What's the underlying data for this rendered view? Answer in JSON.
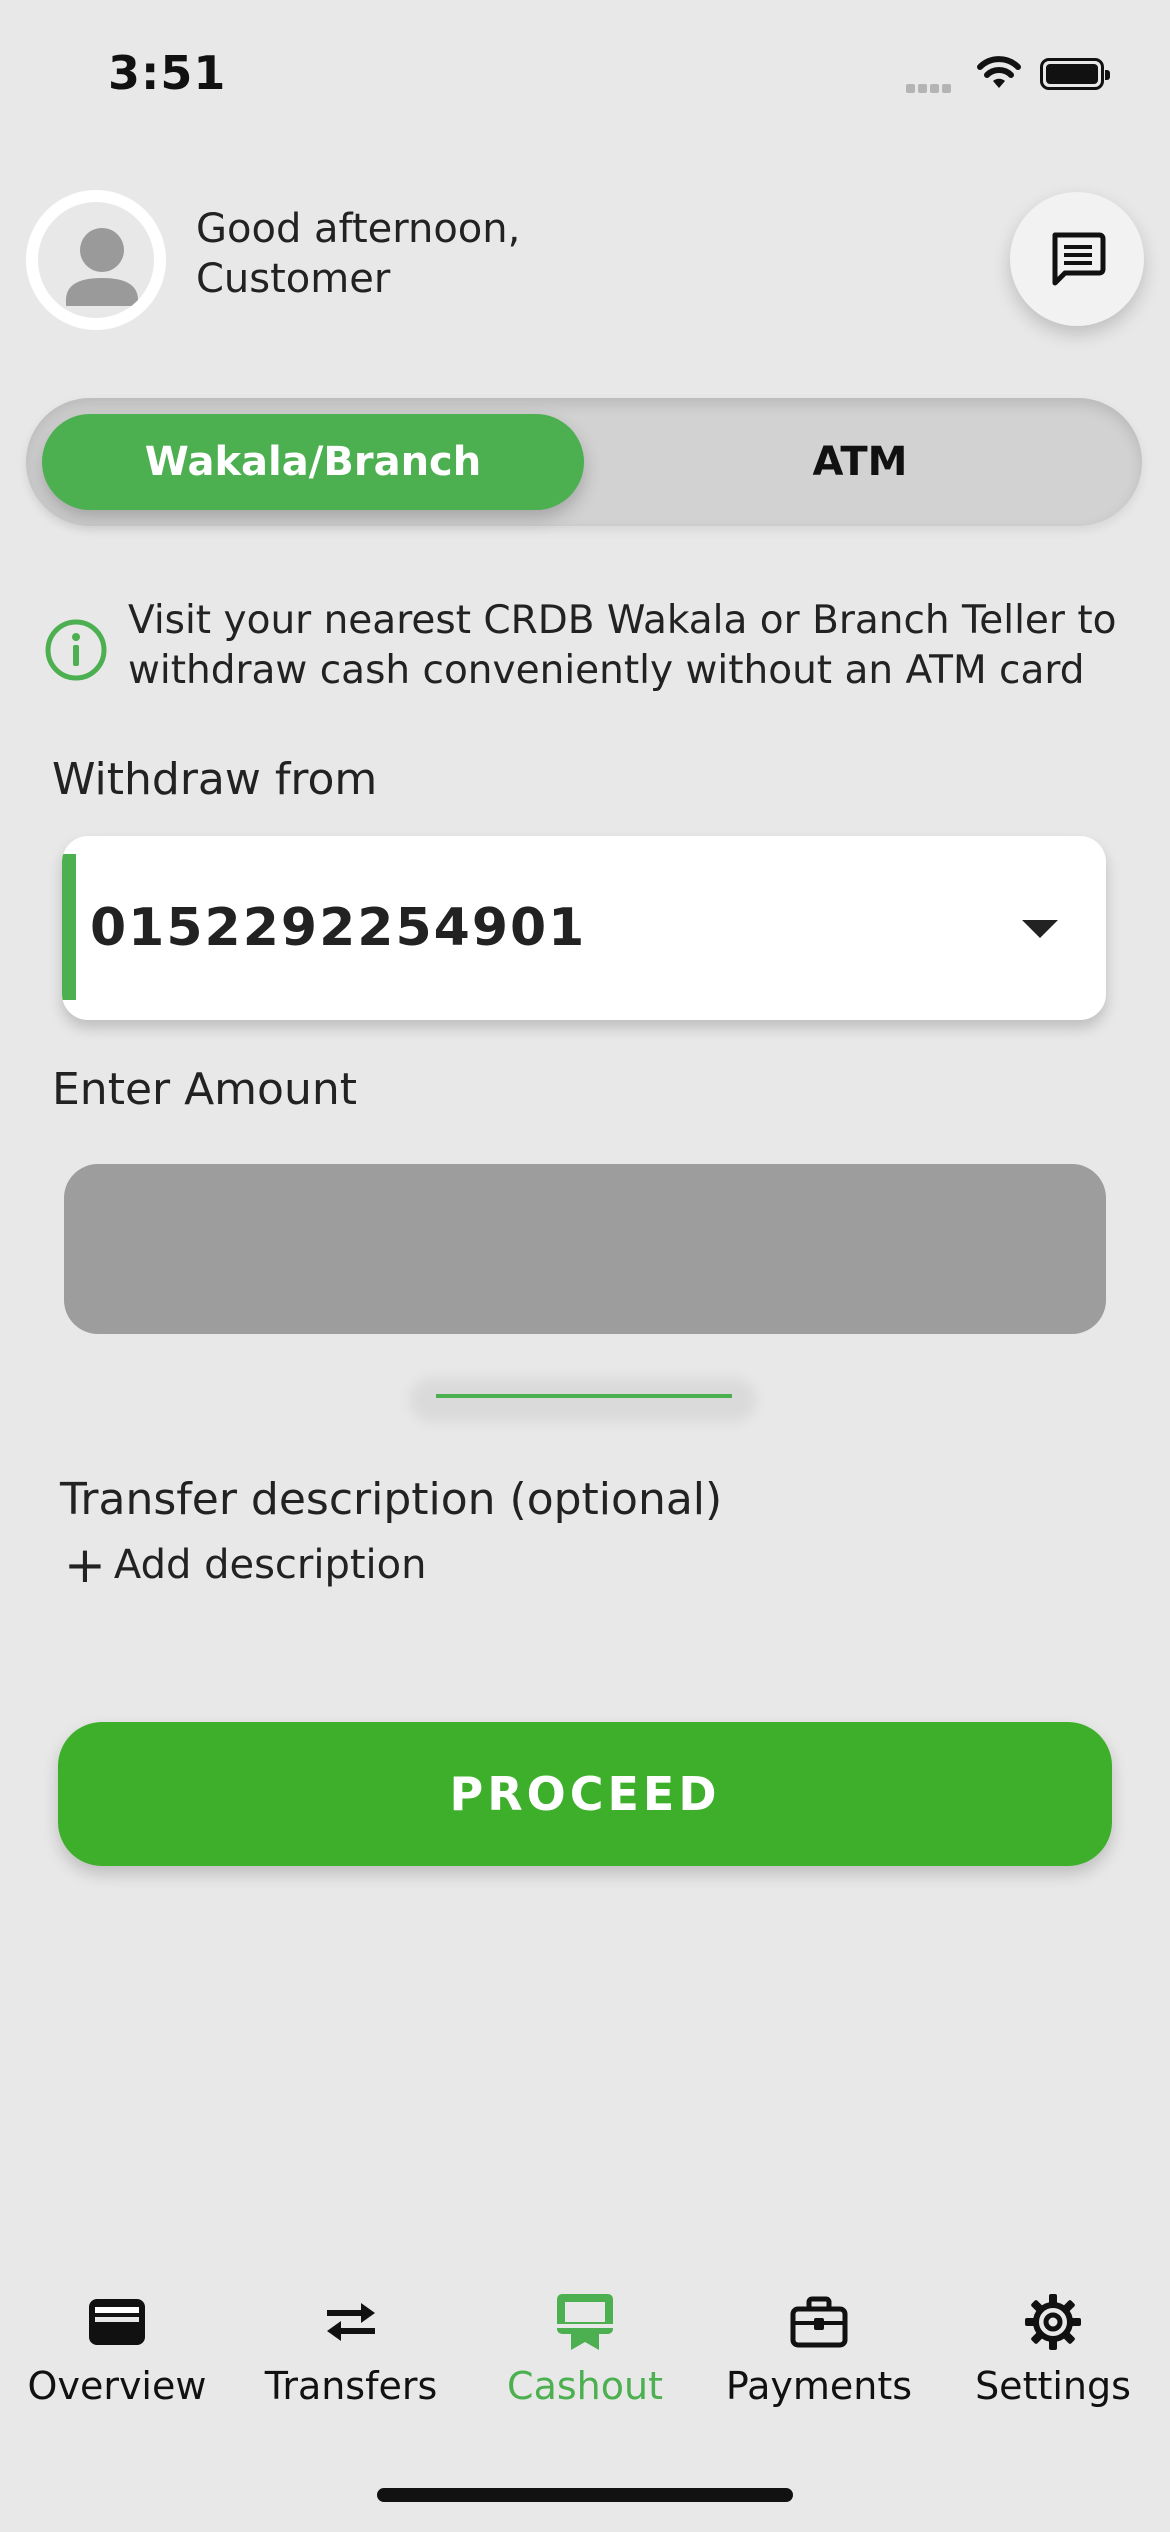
{
  "status_bar": {
    "time": "3:51"
  },
  "header": {
    "greeting_line1": "Good afternoon,",
    "greeting_line2": "Customer"
  },
  "toggle": {
    "options": [
      "Wakala/Branch",
      "ATM"
    ],
    "selected": "Wakala/Branch"
  },
  "info": {
    "text": "Visit your nearest CRDB Wakala or Branch Teller to withdraw cash conveniently without an ATM card"
  },
  "withdraw": {
    "label": "Withdraw from",
    "account": "0152292254901"
  },
  "amount": {
    "label": "Enter Amount",
    "value": ""
  },
  "description": {
    "label": "Transfer description (optional)",
    "add_label": "Add description"
  },
  "proceed_label": "PROCEED",
  "nav": {
    "items": [
      {
        "label": "Overview",
        "icon": "wallet-icon"
      },
      {
        "label": "Transfers",
        "icon": "transfer-arrows-icon"
      },
      {
        "label": "Cashout",
        "icon": "cashout-icon"
      },
      {
        "label": "Payments",
        "icon": "briefcase-icon"
      },
      {
        "label": "Settings",
        "icon": "gear-icon"
      }
    ],
    "active": "Cashout"
  },
  "colors": {
    "accent": "#4caf50",
    "proceed": "#3daf2b",
    "background": "#e8e8e8"
  }
}
